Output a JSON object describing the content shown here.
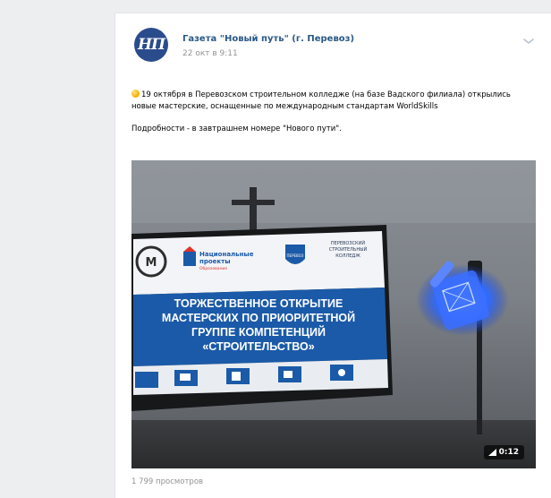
{
  "post": {
    "author": "Газета \"Новый путь\" (г. Перевоз)",
    "avatar_text": "НП",
    "date": "22 окт в 9:11",
    "text_paragraph_1": "19 октября в Перевозском строительном колледже (на базе Вадского филиала) открылись новые мастерские, оснащенные по международным стандартам WorldSkills",
    "text_paragraph_2": "Подробности - в завтрашнем номере \"Нового пути\".",
    "views": "1 799 просмотров",
    "icons": {
      "menu": "chevron-down-icon",
      "emoji": "sparkle-emoji-icon",
      "volume": "volume-icon"
    }
  },
  "video": {
    "duration": "0:12",
    "screen": {
      "logo_m": "M",
      "national_projects_1": "Национальные",
      "national_projects_2": "проекты",
      "national_projects_3": "Образование",
      "college_1": "ПЕРЕВОЗСКИЙ",
      "college_2": "СТРОИТЕЛЬНЫЙ",
      "college_3": "КОЛЛЕДЖ",
      "emblem_text": "ПЕРЕВОЗ",
      "banner_line_1": "ТОРЖЕСТВЕННОЕ ОТКРЫТИЕ",
      "banner_line_2": "МАСТЕРСКИХ ПО ПРИОРИТЕТНОЙ",
      "banner_line_3": "ГРУППЕ КОМПЕТЕНЦИЙ",
      "banner_line_4": "«СТРОИТЕЛЬСТВО»"
    }
  },
  "colors": {
    "page_background": "#edeef0",
    "link": "#2a5885",
    "muted": "#939393",
    "banner_blue": "#1b5aa8",
    "light_glow": "#2f6bff"
  }
}
